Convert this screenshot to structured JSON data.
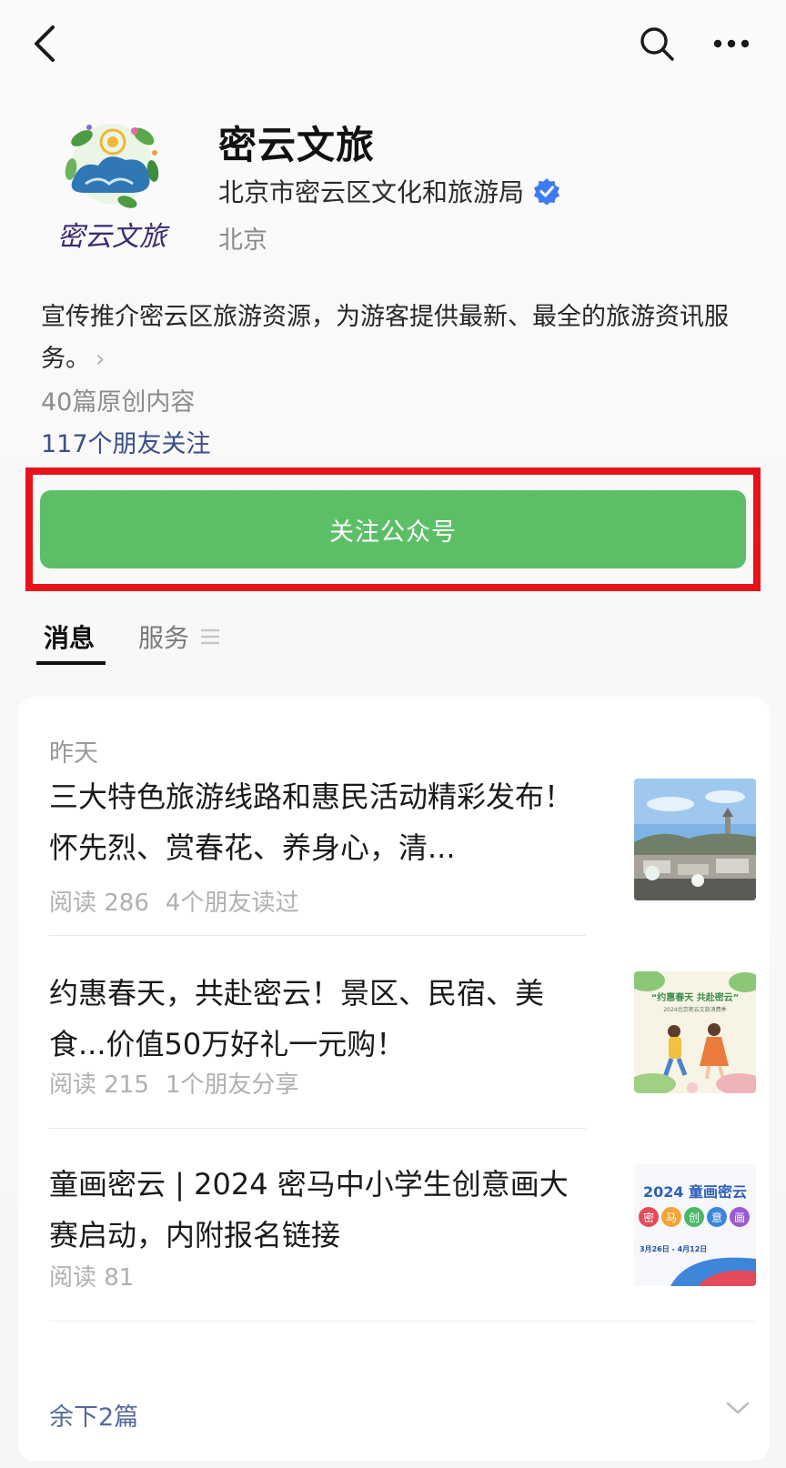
{
  "nav": {
    "back_icon": "chevron-left-icon",
    "search_icon": "search-icon",
    "more_icon": "more-dots-icon"
  },
  "account": {
    "logo_text": "密云文旅",
    "name": "密云文旅",
    "organization": "北京市密云区文化和旅游局",
    "location": "北京",
    "description": "宣传推介密云区旅游资源，为游客提供最新、最全的旅游资讯服务。",
    "original_count": "40篇原创内容",
    "friends_following": "117个朋友关注",
    "follow_button": "关注公众号",
    "verified_color": "#3d7cf0"
  },
  "tabs": [
    {
      "label": "消息",
      "active": true
    },
    {
      "label": "服务",
      "active": false
    }
  ],
  "feed": {
    "date": "昨天",
    "articles": [
      {
        "title": "三大特色旅游线路和惠民活动精彩发布！怀先烈、赏春花、养身心，清...",
        "reads": "阅读 286",
        "social": "4个朋友读过"
      },
      {
        "title": "约惠春天，共赴密云！景区、民宿、美食...价值50万好礼一元购！",
        "reads": "阅读 215",
        "social": "1个朋友分享",
        "thumb_text": "“约惠春天  共赴密云”",
        "thumb_subtext": "2024北京密云文旅消费季"
      },
      {
        "title": "童画密云 | 2024 密马中小学生创意画大赛启动，内附报名链接",
        "reads": "阅读 81",
        "social": "",
        "thumb_title": "2024 童画密云",
        "thumb_chars": [
          "密",
          "马",
          "创",
          "意",
          "画"
        ],
        "thumb_dates": "3月26日 - 4月12日"
      }
    ],
    "remaining": "余下2篇"
  },
  "colors": {
    "follow_green": "#5cbf68",
    "highlight_red": "#e8131a",
    "link_blue": "#3a4f86"
  }
}
